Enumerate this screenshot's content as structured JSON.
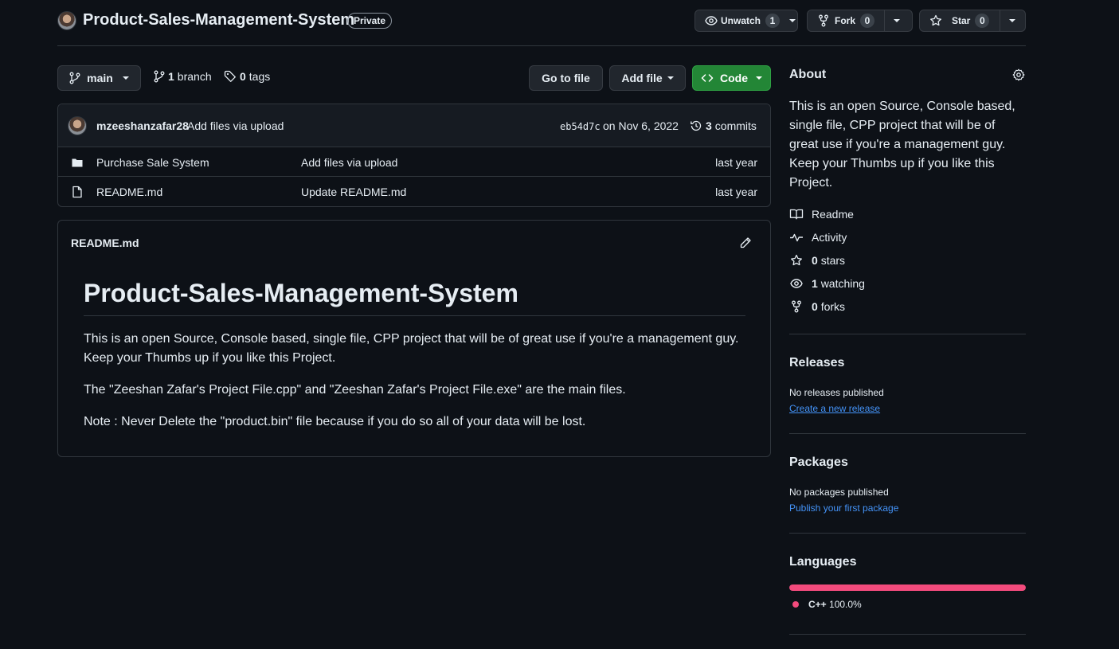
{
  "repo": {
    "title": "Product-Sales-Management-System",
    "visibility": "Private"
  },
  "actions": {
    "unwatch_label": "Unwatch",
    "unwatch_count": "1",
    "fork_label": "Fork",
    "fork_count": "0",
    "star_label": "Star",
    "star_count": "0"
  },
  "branchbar": {
    "branch_name": "main",
    "branch_count": "1",
    "branch_word": "branch",
    "tag_count": "0",
    "tag_word": "tags",
    "go_to_file": "Go to file",
    "add_file": "Add file",
    "code": "Code"
  },
  "commit": {
    "author": "mzeeshanzafar28",
    "message": "Add files via upload",
    "hash": "eb54d7c",
    "date": "on Nov 6, 2022",
    "commit_count": "3",
    "commit_word": "commits"
  },
  "files": [
    {
      "type": "folder",
      "name": "Purchase Sale System",
      "message": "Add files via upload",
      "age": "last year"
    },
    {
      "type": "file",
      "name": "README.md",
      "message": "Update README.md",
      "age": "last year"
    }
  ],
  "readme": {
    "filename": "README.md",
    "heading": "Product-Sales-Management-System",
    "paragraphs": [
      "This is an open Source, Console based, single file, CPP project that will be of great use if you're a management guy. Keep your Thumbs up if you like this Project.",
      "The \"Zeeshan Zafar's Project File.cpp\" and \"Zeeshan Zafar's Project File.exe\" are the main files.",
      "Note : Never Delete the \"product.bin\" file because if you do so all of your data will be lost."
    ]
  },
  "about": {
    "title": "About",
    "description": "This is an open Source, Console based, single file, CPP project that will be of great use if you're a management guy. Keep your Thumbs up if you like this Project.",
    "readme": "Readme",
    "activity": "Activity",
    "stars_count": "0",
    "stars_word": "stars",
    "watching_count": "1",
    "watching_word": "watching",
    "forks_count": "0",
    "forks_word": "forks"
  },
  "releases": {
    "title": "Releases",
    "empty": "No releases published",
    "link": "Create a new release"
  },
  "packages": {
    "title": "Packages",
    "empty": "No packages published",
    "link": "Publish your first package"
  },
  "languages": {
    "title": "Languages",
    "items": [
      {
        "name": "C++",
        "percent": "100.0%",
        "fraction": 1.0,
        "color": "#f34b7d"
      }
    ]
  },
  "colors": {
    "background": "#0d1117",
    "border": "#30363d",
    "accent_green": "#238636",
    "link_blue": "#4493f8",
    "cpp_pink": "#f34b7d"
  }
}
